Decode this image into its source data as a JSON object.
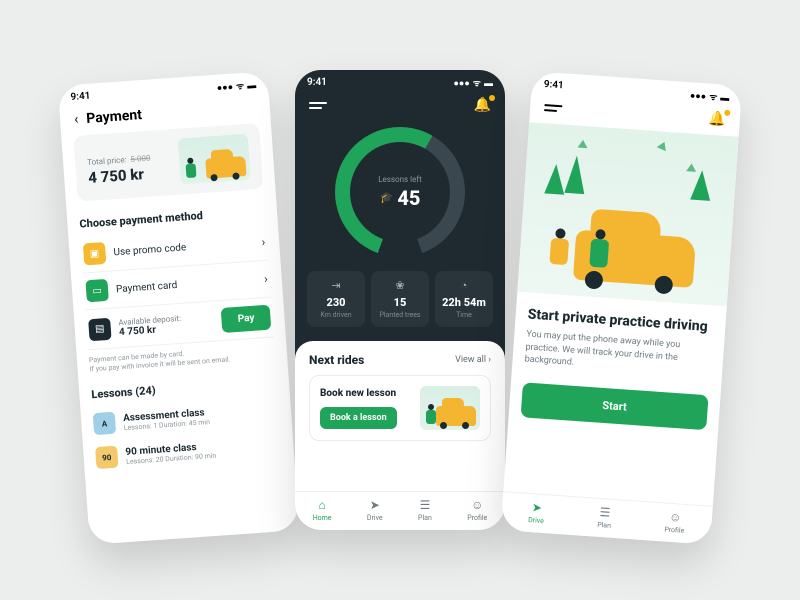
{
  "status_time": "9:41",
  "screens": {
    "payment": {
      "title": "Payment",
      "price_card": {
        "label": "Total price:",
        "old": "5 000",
        "amount": "4 750 kr"
      },
      "choose_heading": "Choose payment method",
      "methods": {
        "promo": "Use promo code",
        "card": "Payment card",
        "deposit_label": "Available deposit:",
        "deposit_value": "4 750 kr",
        "pay_label": "Pay"
      },
      "note": "Payment can be made by card.\nIf you pay with invoice it will be sent on email.",
      "lessons_heading": "Lessons (24)",
      "lessons": [
        {
          "badge": "A",
          "title": "Assessment class",
          "sub": "Lessons: 1     Duration: 45 min",
          "color": "#9fd0e8"
        },
        {
          "badge": "90",
          "title": "90 minute class",
          "sub": "Lessons: 20     Duration: 90 min",
          "color": "#f3c96b"
        }
      ]
    },
    "home": {
      "gauge": {
        "caption": "Lessons left",
        "value": "45"
      },
      "stats": [
        {
          "icon": "⇥",
          "value": "230",
          "label": "Km driven"
        },
        {
          "icon": "❀",
          "value": "15",
          "label": "Planted trees"
        },
        {
          "icon": "◔",
          "value": "22h 54m",
          "label": "Time"
        }
      ],
      "next_rides": "Next rides",
      "view_all": "View all ›",
      "book_title": "Book new lesson",
      "book_btn": "Book a lesson",
      "tabs": [
        "Home",
        "Drive",
        "Plan",
        "Profile"
      ]
    },
    "drive": {
      "heading": "Start private practice driving",
      "body": "You may put the phone away while you practice. We will track your drive in the background.",
      "start": "Start",
      "tabs": [
        "Drive",
        "Plan",
        "Profile"
      ]
    }
  }
}
